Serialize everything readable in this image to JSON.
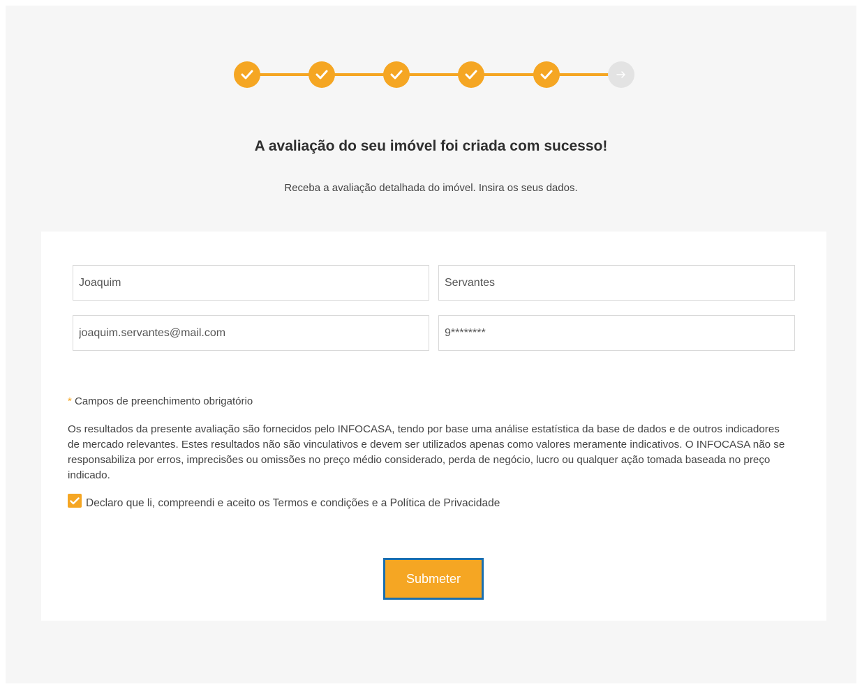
{
  "stepper": {
    "steps": [
      {
        "status": "complete",
        "icon": "check-icon"
      },
      {
        "status": "complete",
        "icon": "check-icon"
      },
      {
        "status": "complete",
        "icon": "check-icon"
      },
      {
        "status": "complete",
        "icon": "check-icon"
      },
      {
        "status": "complete",
        "icon": "check-icon"
      },
      {
        "status": "pending",
        "icon": "arrow-right-icon"
      }
    ],
    "accent_color": "#f5a623",
    "pending_color": "#e3e3e3"
  },
  "header": {
    "title": "A avaliação do seu imóvel foi criada com sucesso!",
    "subtitle": "Receba a avaliação detalhada do imóvel. Insira os seus dados."
  },
  "form": {
    "first_name": {
      "value": "Joaquim"
    },
    "last_name": {
      "value": "Servantes"
    },
    "email": {
      "value": "joaquim.servantes@mail.com"
    },
    "phone": {
      "value": "9********"
    },
    "required_star": "*",
    "required_note": " Campos de preenchimento obrigatório",
    "disclaimer": "Os resultados da presente avaliação são fornecidos pelo INFOCASA, tendo por base uma análise estatística da base de dados e de outros indicadores de mercado relevantes. Estes resultados não são vinculativos e devem ser utilizados apenas como valores meramente indicativos. O INFOCASA não se responsabiliza por erros, imprecisões ou omissões no preço médio considerado, perda de negócio, lucro ou qualquer ação tomada baseada no preço indicado.",
    "consent_checked": true,
    "consent_label": "Declaro que li, compreendi e aceito os Termos e condições e a Política de Privacidade",
    "submit_label": "Submeter"
  }
}
